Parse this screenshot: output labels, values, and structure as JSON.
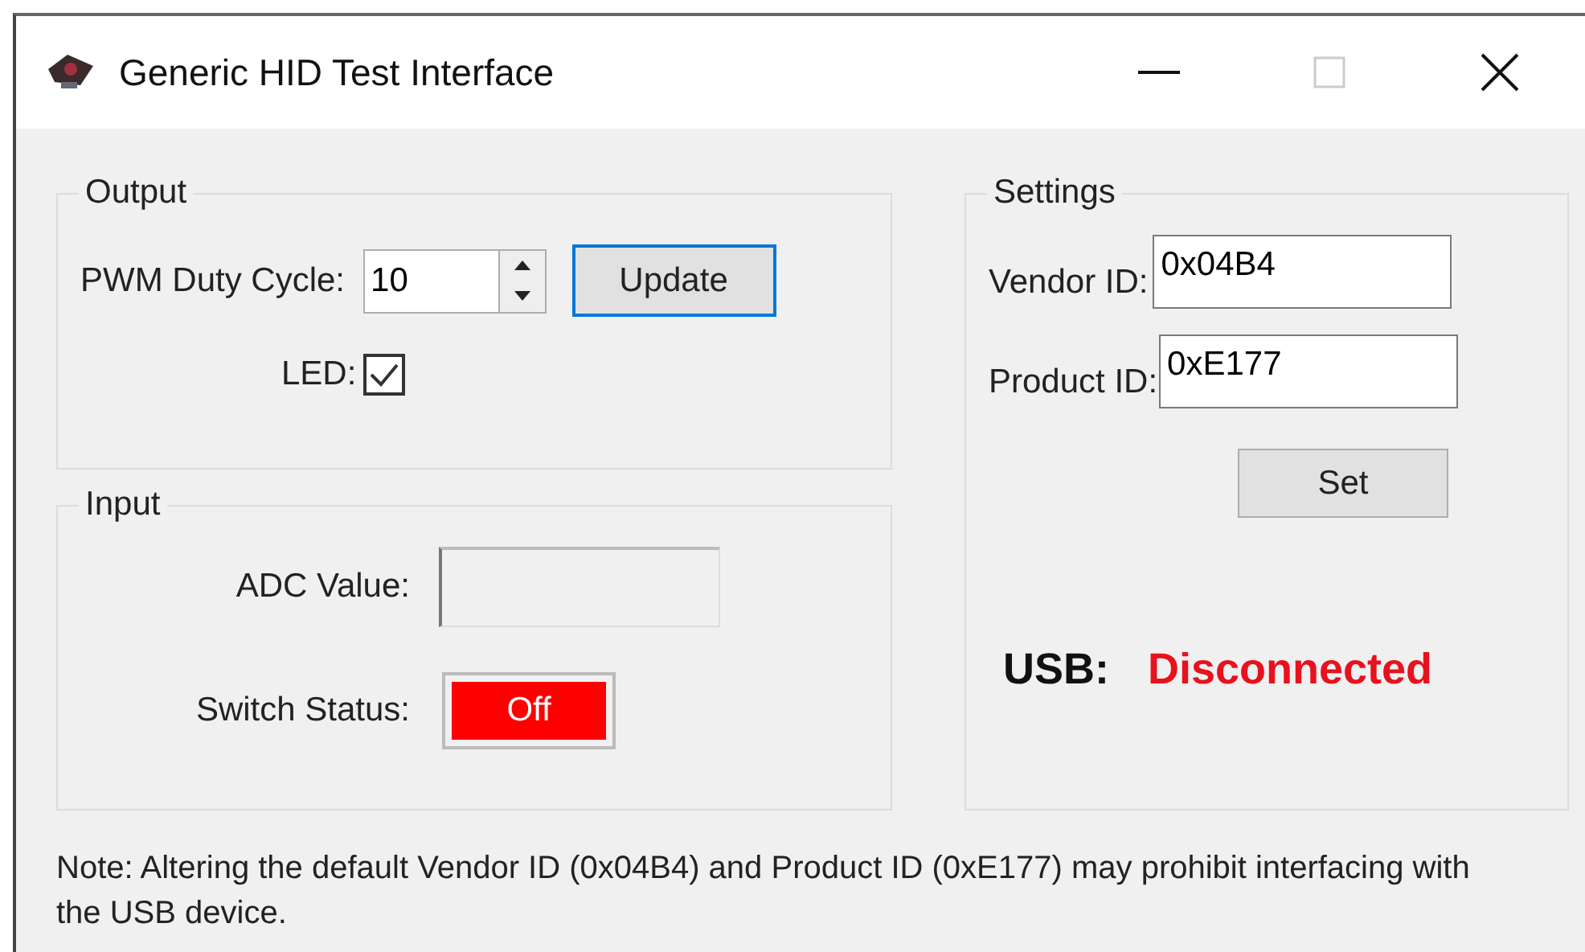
{
  "window": {
    "title": "Generic HID Test Interface",
    "maximize_disabled": true
  },
  "output": {
    "title": "Output",
    "pwm_label": "PWM Duty Cycle:",
    "pwm_value": "10",
    "update_button": "Update",
    "led_label": "LED:",
    "led_checked": true
  },
  "input": {
    "title": "Input",
    "adc_label": "ADC Value:",
    "adc_value_disabled": true,
    "switch_label": "Switch Status:",
    "switch_status": {
      "text": "Off",
      "on": false
    }
  },
  "settings": {
    "title": "Settings",
    "vendor_label": "Vendor ID:",
    "vendor_value": "0x04B4",
    "product_label": "Product ID:",
    "product_value": "0xE177",
    "set_button": "Set",
    "usb_label": "USB:",
    "usb_status": {
      "text": "Disconnected",
      "connected": false
    }
  },
  "note": "Note: Altering the default Vendor ID (0x04B4) and Product ID (0xE177) may prohibit interfacing with the USB device."
}
